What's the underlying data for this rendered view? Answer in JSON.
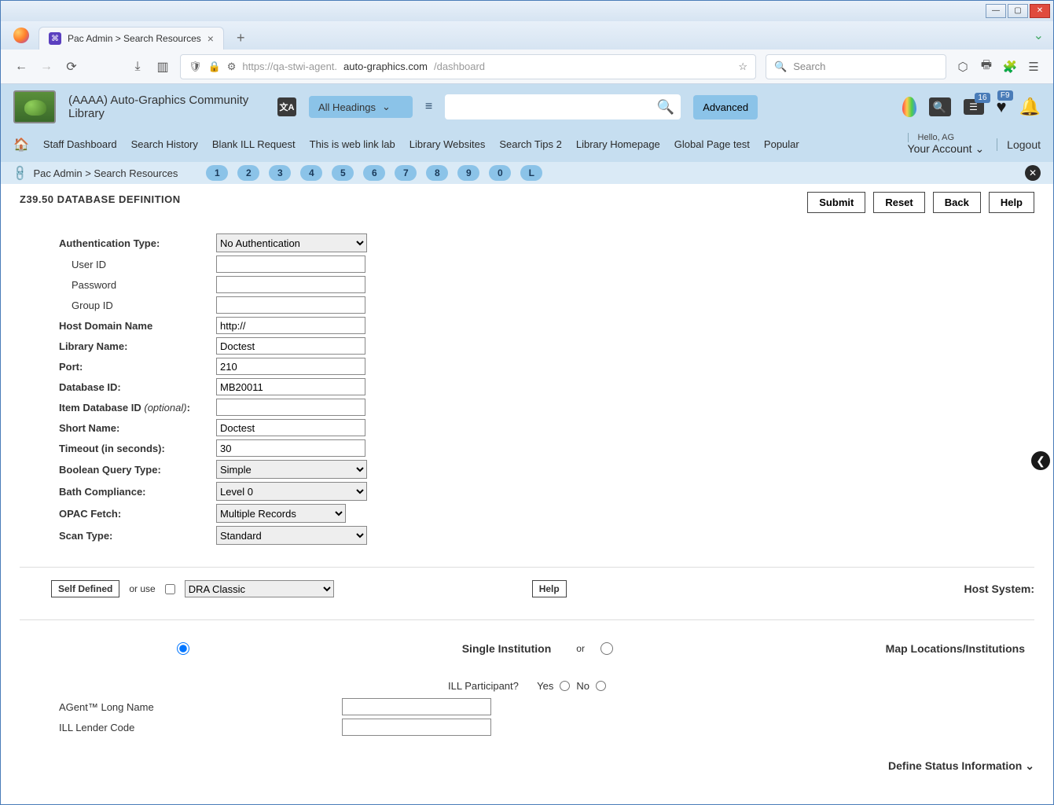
{
  "browser": {
    "tab_title": "Pac Admin > Search Resources",
    "url_prefix": "https://qa-stwi-agent.",
    "url_host": "auto-graphics.com",
    "url_path": "/dashboard",
    "search_placeholder": "Search",
    "new_tab": "+",
    "close_tab": "×",
    "overflow": "⌄"
  },
  "header": {
    "org_name": "(AAAA) Auto-Graphics Community Library",
    "search_heading": "All Headings",
    "advanced": "Advanced",
    "badge_list": "16",
    "badge_heart": "F9"
  },
  "nav": {
    "items": [
      "Staff Dashboard",
      "Search History",
      "Blank ILL Request",
      "This is web link lab",
      "Library Websites",
      "Search Tips 2",
      "Library Homepage",
      "Global Page test",
      "Popular"
    ],
    "greeting": "Hello, AG",
    "account": "Your Account",
    "logout": "Logout"
  },
  "breadcrumb": {
    "path": "Pac Admin > Search Resources",
    "pills": [
      "1",
      "2",
      "3",
      "4",
      "5",
      "6",
      "7",
      "8",
      "9",
      "0",
      "L"
    ]
  },
  "page": {
    "title": "Z39.50 DATABASE DEFINITION",
    "submit": "Submit",
    "reset": "Reset",
    "back": "Back",
    "help": "Help"
  },
  "form": {
    "auth_type_label": "Authentication Type:",
    "auth_type_value": "No Authentication",
    "user_id_label": "User ID",
    "user_id_value": "",
    "password_label": "Password",
    "password_value": "",
    "group_id_label": "Group ID",
    "group_id_value": "",
    "host_domain_label": "Host Domain Name",
    "host_domain_value": "http://",
    "library_name_label": "Library Name:",
    "library_name_value": "Doctest",
    "port_label": "Port:",
    "port_value": "210",
    "database_id_label": "Database ID:",
    "database_id_value": "MB20011",
    "item_db_label": "Item Database ID ",
    "item_db_optional": "(optional)",
    "item_db_value": "",
    "short_name_label": "Short Name:",
    "short_name_value": "Doctest",
    "timeout_label": "Timeout (in seconds):",
    "timeout_value": "30",
    "bool_query_label": "Boolean Query Type:",
    "bool_query_value": "Simple",
    "bath_label": "Bath Compliance:",
    "bath_value": "Level 0",
    "opac_label": "OPAC Fetch:",
    "opac_value": "Multiple Records",
    "scan_label": "Scan Type:",
    "scan_value": "Standard"
  },
  "host_system": {
    "label": "Host System:",
    "self_defined": "Self Defined",
    "or_use": "or use",
    "dropdown": "DRA Classic",
    "help": "Help"
  },
  "institution": {
    "single": "Single Institution",
    "or": "or",
    "map": "Map Locations/Institutions"
  },
  "ill": {
    "participant_label": "ILL Participant?",
    "yes": "Yes",
    "no": "No",
    "long_name_label": "AGent™ Long Name",
    "long_name_value": "",
    "lender_code_label": "ILL Lender Code",
    "lender_code_value": ""
  },
  "footer": {
    "define_status": "Define Status Information"
  }
}
